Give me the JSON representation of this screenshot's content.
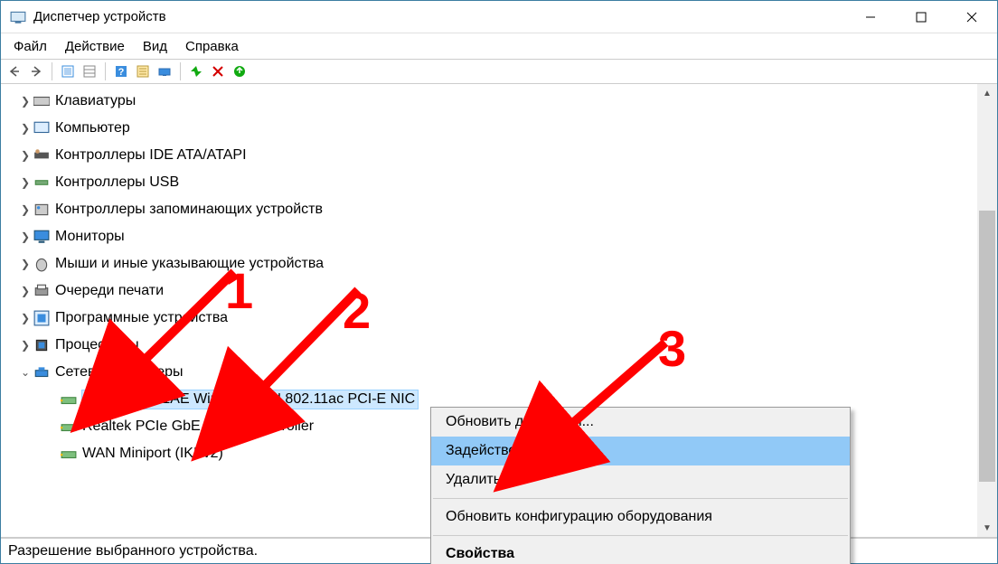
{
  "window": {
    "title": "Диспетчер устройств"
  },
  "menu": {
    "file": "Файл",
    "action": "Действие",
    "view": "Вид",
    "help": "Справка"
  },
  "tree": {
    "items": [
      {
        "label": "Клавиатуры",
        "expander": ">"
      },
      {
        "label": "Компьютер",
        "expander": ">"
      },
      {
        "label": "Контроллеры IDE ATA/ATAPI",
        "expander": ">"
      },
      {
        "label": "Контроллеры USB",
        "expander": ">"
      },
      {
        "label": "Контроллеры запоминающих устройств",
        "expander": ">"
      },
      {
        "label": "Мониторы",
        "expander": ">"
      },
      {
        "label": "Мыши и иные указывающие устройства",
        "expander": ">"
      },
      {
        "label": "Очереди печати",
        "expander": ">"
      },
      {
        "label": "Программные устройства",
        "expander": ">"
      },
      {
        "label": "Процессоры",
        "expander": ">"
      },
      {
        "label": "Сетевые адаптеры",
        "expander": "v",
        "expanded": true
      }
    ],
    "children": [
      {
        "label": "Realtek 8821AE Wireless LAN 802.11ac PCI-E NIC",
        "selected": true
      },
      {
        "label": "Realtek PCIe GbE Family Controller"
      },
      {
        "label": "WAN Miniport (IKEv2)"
      }
    ]
  },
  "context_menu": {
    "update": "Обновить драйверы...",
    "enable": "Задействовать",
    "delete": "Удалить",
    "scan": "Обновить конфигурацию оборудования",
    "properties": "Свойства"
  },
  "statusbar": "Разрешение выбранного устройства.",
  "annotations": {
    "n1": "1",
    "n2": "2",
    "n3": "3"
  }
}
